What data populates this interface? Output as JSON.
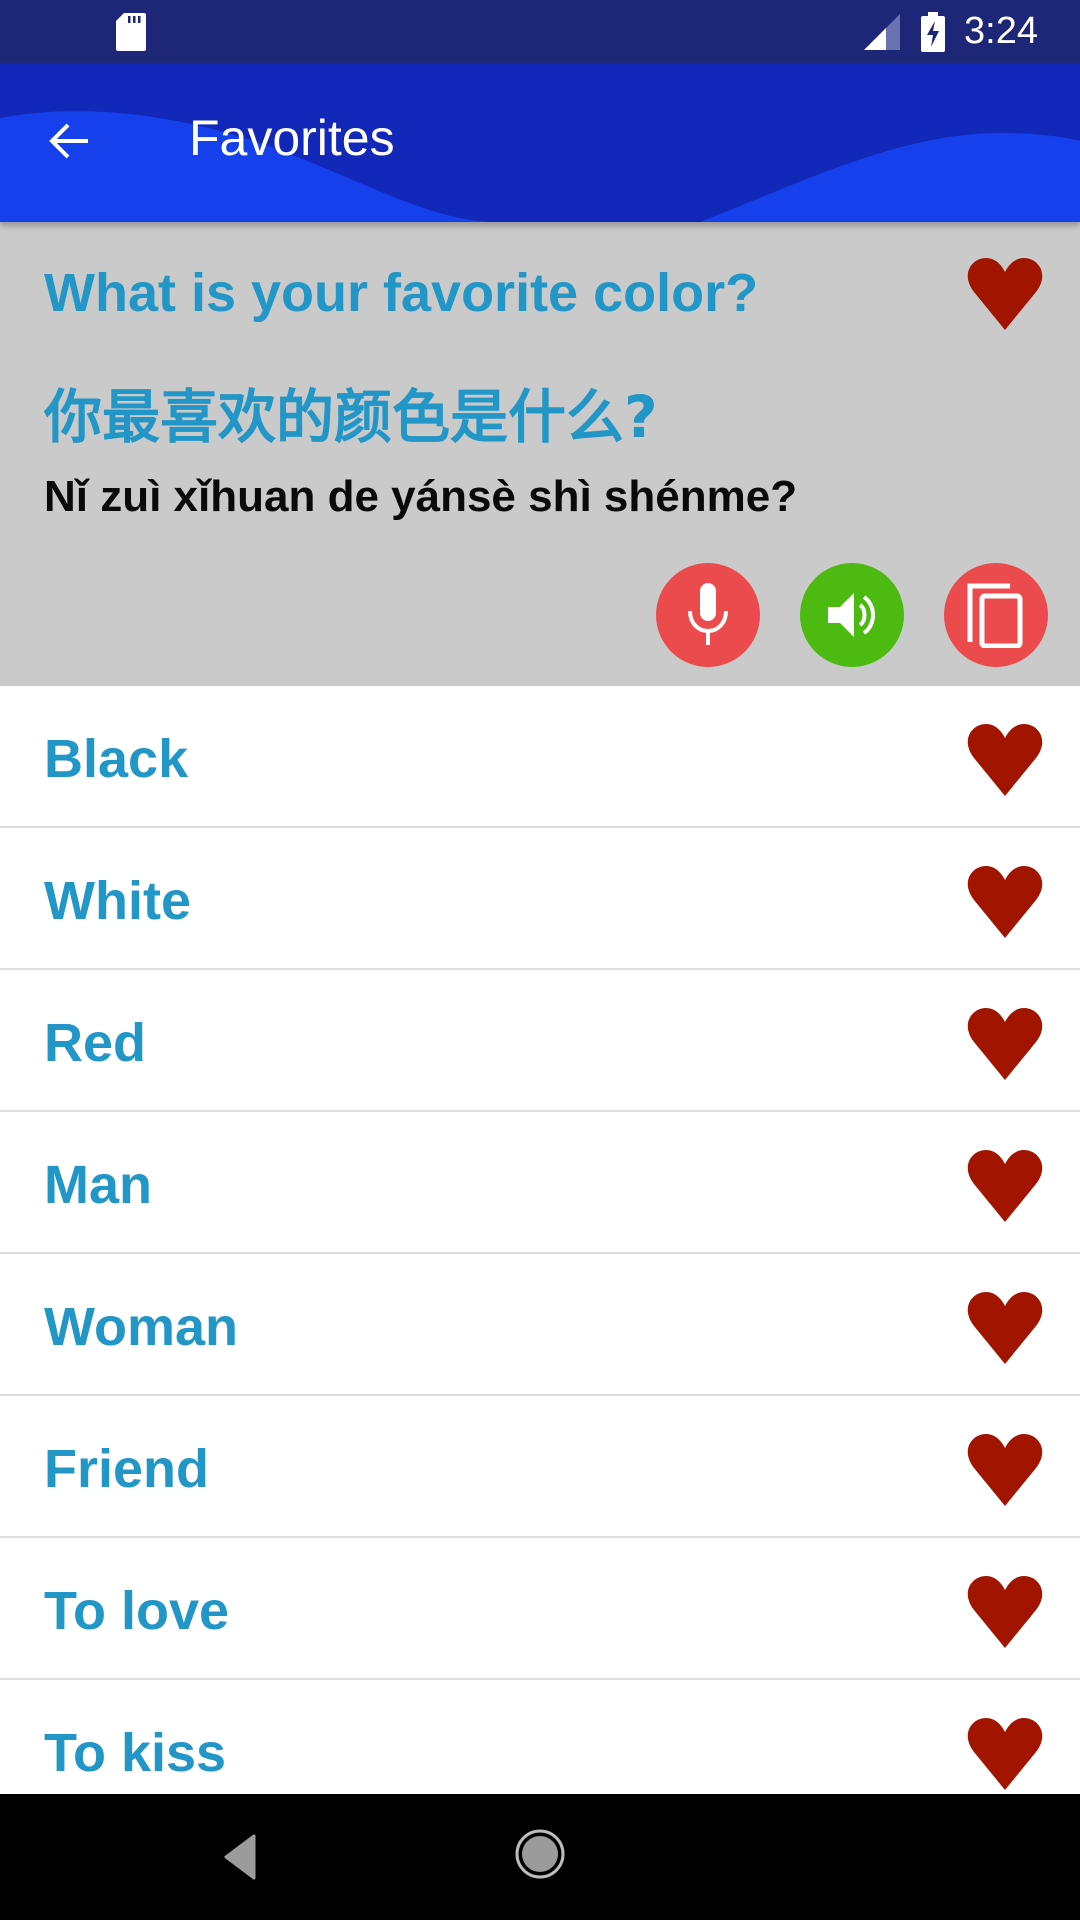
{
  "status_bar": {
    "time": "3:24",
    "icons": [
      "sd-card-icon",
      "signal-icon",
      "battery-charging-icon"
    ]
  },
  "app_bar": {
    "title": "Favorites",
    "back_icon": "arrow-back-icon"
  },
  "selected_phrase": {
    "english": "What is your favorite color?",
    "chinese": "你最喜欢的颜色是什么?",
    "pinyin": "Nǐ zuì xǐhuan de yánsè shì shénme?",
    "favorited": true,
    "actions": [
      {
        "name": "record",
        "icon": "microphone-icon",
        "color": "#ec4b4d"
      },
      {
        "name": "play",
        "icon": "speaker-icon",
        "color": "#4cba10"
      },
      {
        "name": "copy",
        "icon": "copy-icon",
        "color": "#ec4b4d"
      }
    ]
  },
  "favorites": [
    {
      "label": "Black",
      "favorited": true
    },
    {
      "label": "White",
      "favorited": true
    },
    {
      "label": "Red",
      "favorited": true
    },
    {
      "label": "Man",
      "favorited": true
    },
    {
      "label": "Woman",
      "favorited": true
    },
    {
      "label": "Friend",
      "favorited": true
    },
    {
      "label": "To love",
      "favorited": true
    },
    {
      "label": "To kiss",
      "favorited": true
    }
  ],
  "colors": {
    "status_bar": "#1e2678",
    "app_bar": "#1128b8",
    "accent_text": "#2196c7",
    "heart": "#a01400",
    "card_bg": "#cacaca"
  },
  "nav_bar": {
    "buttons": [
      "back-triangle-icon",
      "home-circle-icon"
    ]
  }
}
